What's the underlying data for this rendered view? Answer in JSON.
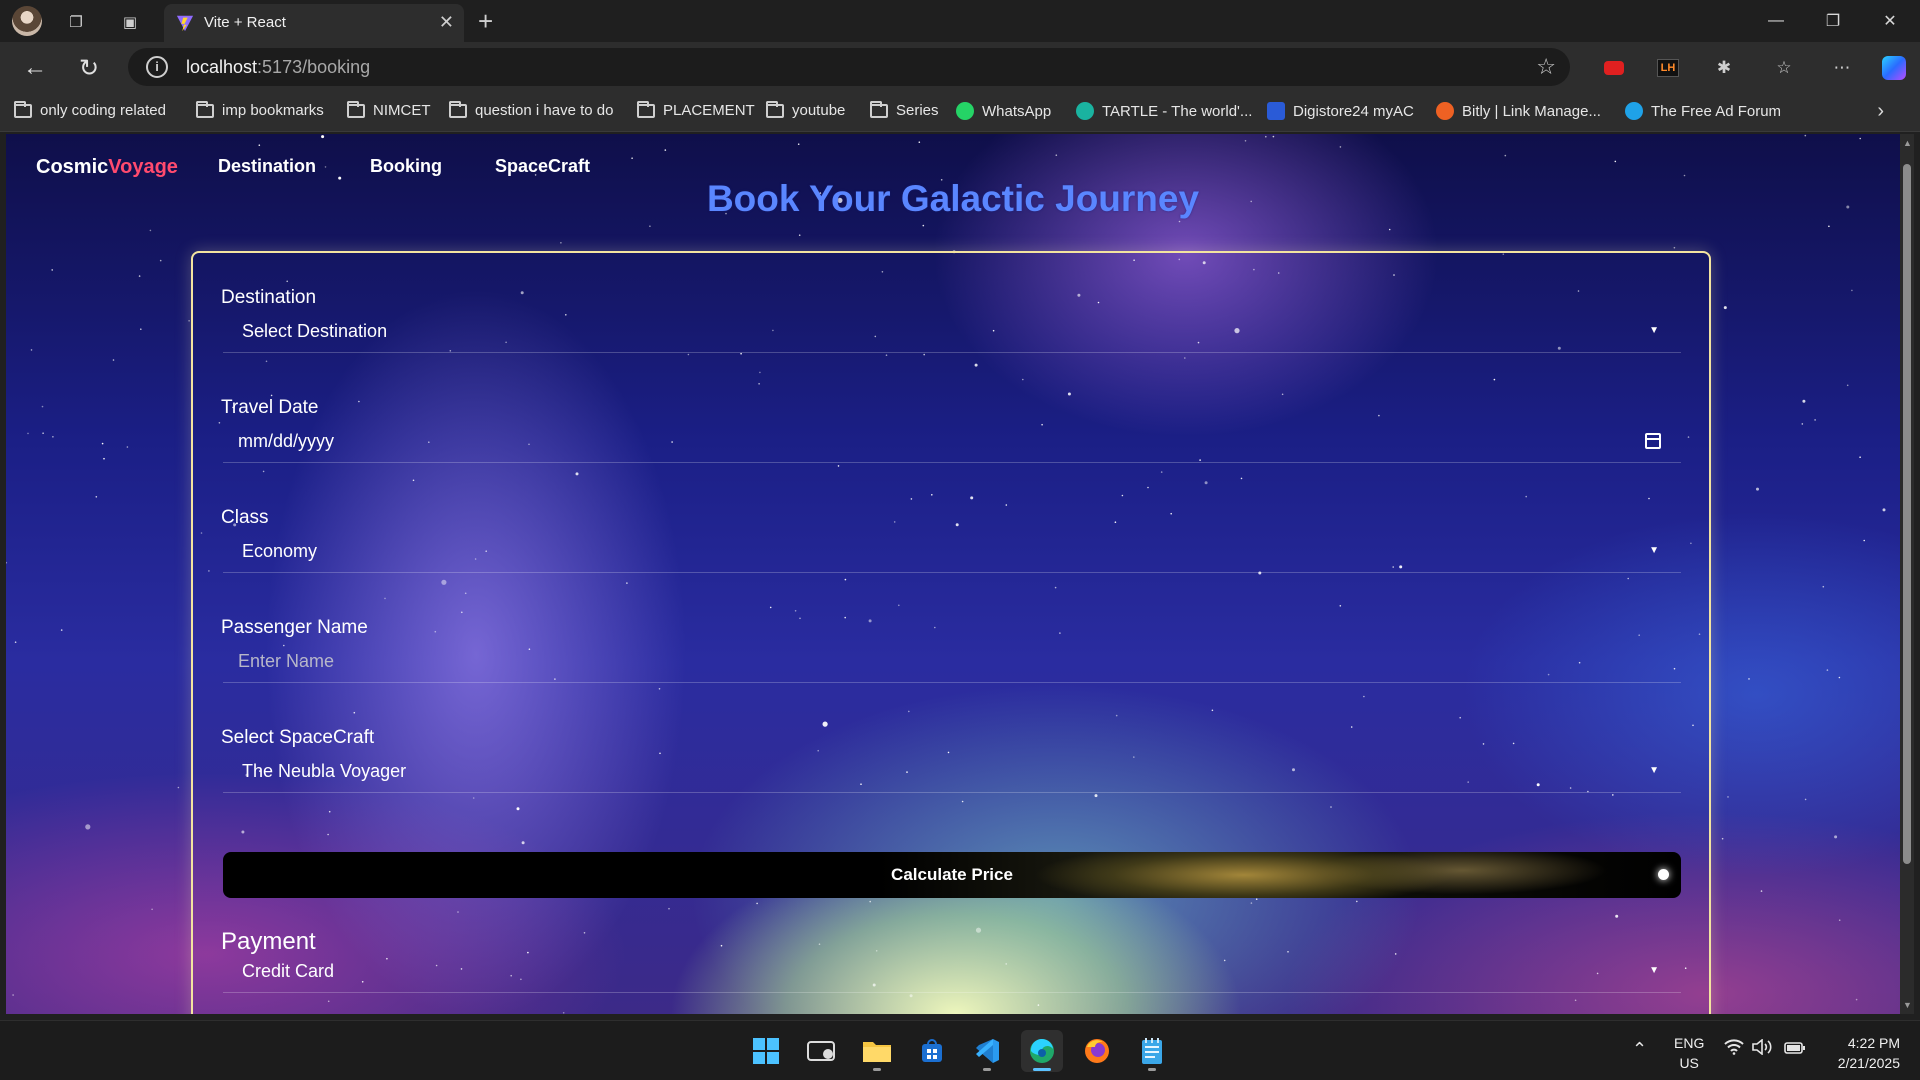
{
  "browser": {
    "tab_title": "Vite + React",
    "url_host": "localhost",
    "url_path": ":5173/booking",
    "bookmarks": [
      {
        "label": "only coding  related",
        "icon": "folder-icon"
      },
      {
        "label": "imp bookmarks",
        "icon": "folder-icon"
      },
      {
        "label": "NIMCET",
        "icon": "folder-icon"
      },
      {
        "label": "question i have to do",
        "icon": "folder-icon"
      },
      {
        "label": "PLACEMENT",
        "icon": "folder-icon"
      },
      {
        "label": "youtube",
        "icon": "folder-icon"
      },
      {
        "label": "Series",
        "icon": "folder-icon"
      },
      {
        "label": "WhatsApp",
        "icon": "whatsapp-icon"
      },
      {
        "label": "TARTLE - The world'...",
        "icon": "tartle-icon"
      },
      {
        "label": "Digistore24 myAC",
        "icon": "digistore-icon"
      },
      {
        "label": "Bitly | Link Manage...",
        "icon": "bitly-icon"
      },
      {
        "label": "The Free Ad Forum",
        "icon": "forum-icon"
      }
    ],
    "extensions": [
      "youtube-ext-icon",
      "lh-ext-icon",
      "puzzle-icon",
      "favorites-icon",
      "more-icon",
      "copilot-icon"
    ],
    "ext_lh_label": "LH"
  },
  "app": {
    "logo_part1": "Cosmic",
    "logo_part2": "Voyage",
    "nav": [
      "Destination",
      "Booking",
      "SpaceCraft"
    ],
    "title": "Book Your Galactic Journey",
    "form": {
      "destination_label": "Destination",
      "destination_value": "Select Destination",
      "date_label": "Travel Date",
      "date_value": "mm/dd/yyyy",
      "class_label": "Class",
      "class_value": "Economy",
      "name_label": "Passenger Name",
      "name_placeholder": "Enter Name",
      "spacecraft_label": "Select SpaceCraft",
      "spacecraft_value": "The Neubla Voyager",
      "calculate_label": "Calculate Price",
      "payment_heading": "Payment",
      "payment_value": "Credit Card"
    }
  },
  "taskbar": {
    "apps": [
      "start-icon",
      "widgets-icon",
      "file-explorer-icon",
      "store-icon",
      "vscode-icon",
      "edge-icon",
      "firefox-icon",
      "notepad-icon"
    ],
    "lang_line1": "ENG",
    "lang_line2": "US",
    "time": "4:22 PM",
    "date": "2/21/2025"
  },
  "colors": {
    "title_blue": "#5a86ff",
    "logo_accent": "#ff4a6e",
    "card_border": "#f3e3a0"
  }
}
